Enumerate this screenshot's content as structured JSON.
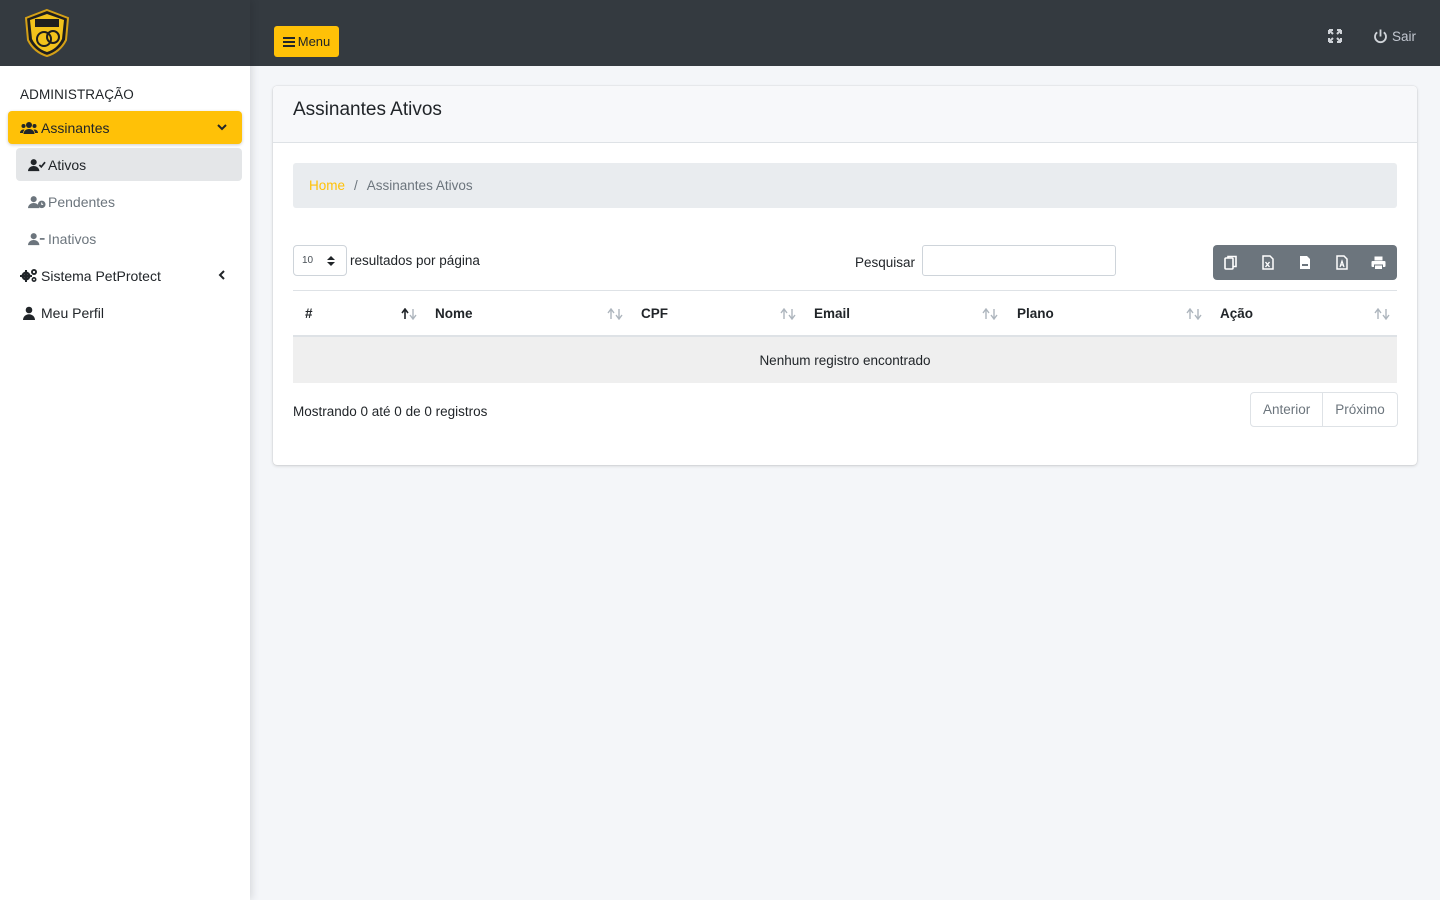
{
  "sidebar": {
    "logo_icon": "petprotect-logo-icon",
    "section_header": "ADMINISTRAÇÃO",
    "items": [
      {
        "label": "Assinantes",
        "icon": "users-icon"
      },
      {
        "label": "Sistema PetProtect",
        "icon": "cogs-icon"
      },
      {
        "label": "Meu Perfil",
        "icon": "user-icon"
      }
    ],
    "subitems": [
      {
        "label": "Ativos",
        "icon": "user-check-icon"
      },
      {
        "label": "Pendentes",
        "icon": "user-clock-icon"
      },
      {
        "label": "Inativos",
        "icon": "user-minus-icon"
      }
    ]
  },
  "topbar": {
    "menu_label": "Menu",
    "logout_label": "Sair"
  },
  "page": {
    "title": "Assinantes Ativos",
    "breadcrumb": {
      "home": "Home",
      "separator": "/",
      "current": "Assinantes Ativos"
    }
  },
  "table_controls": {
    "page_length": "10",
    "length_label": "resultados por página",
    "search_label": "Pesquisar",
    "search_value": "",
    "export_buttons": [
      "copy-icon",
      "excel-icon",
      "csv-icon",
      "pdf-icon",
      "print-icon"
    ]
  },
  "table": {
    "columns": [
      "#",
      "Nome",
      "CPF",
      "Email",
      "Plano",
      "Ação"
    ],
    "empty_message": "Nenhum registro encontrado",
    "info": "Mostrando 0 até 0 de 0 registros",
    "pagination": {
      "prev": "Anterior",
      "next": "Próximo"
    }
  },
  "colors": {
    "accent": "#ffc107",
    "topbar": "#343a40",
    "button_secondary": "#6c757d"
  }
}
